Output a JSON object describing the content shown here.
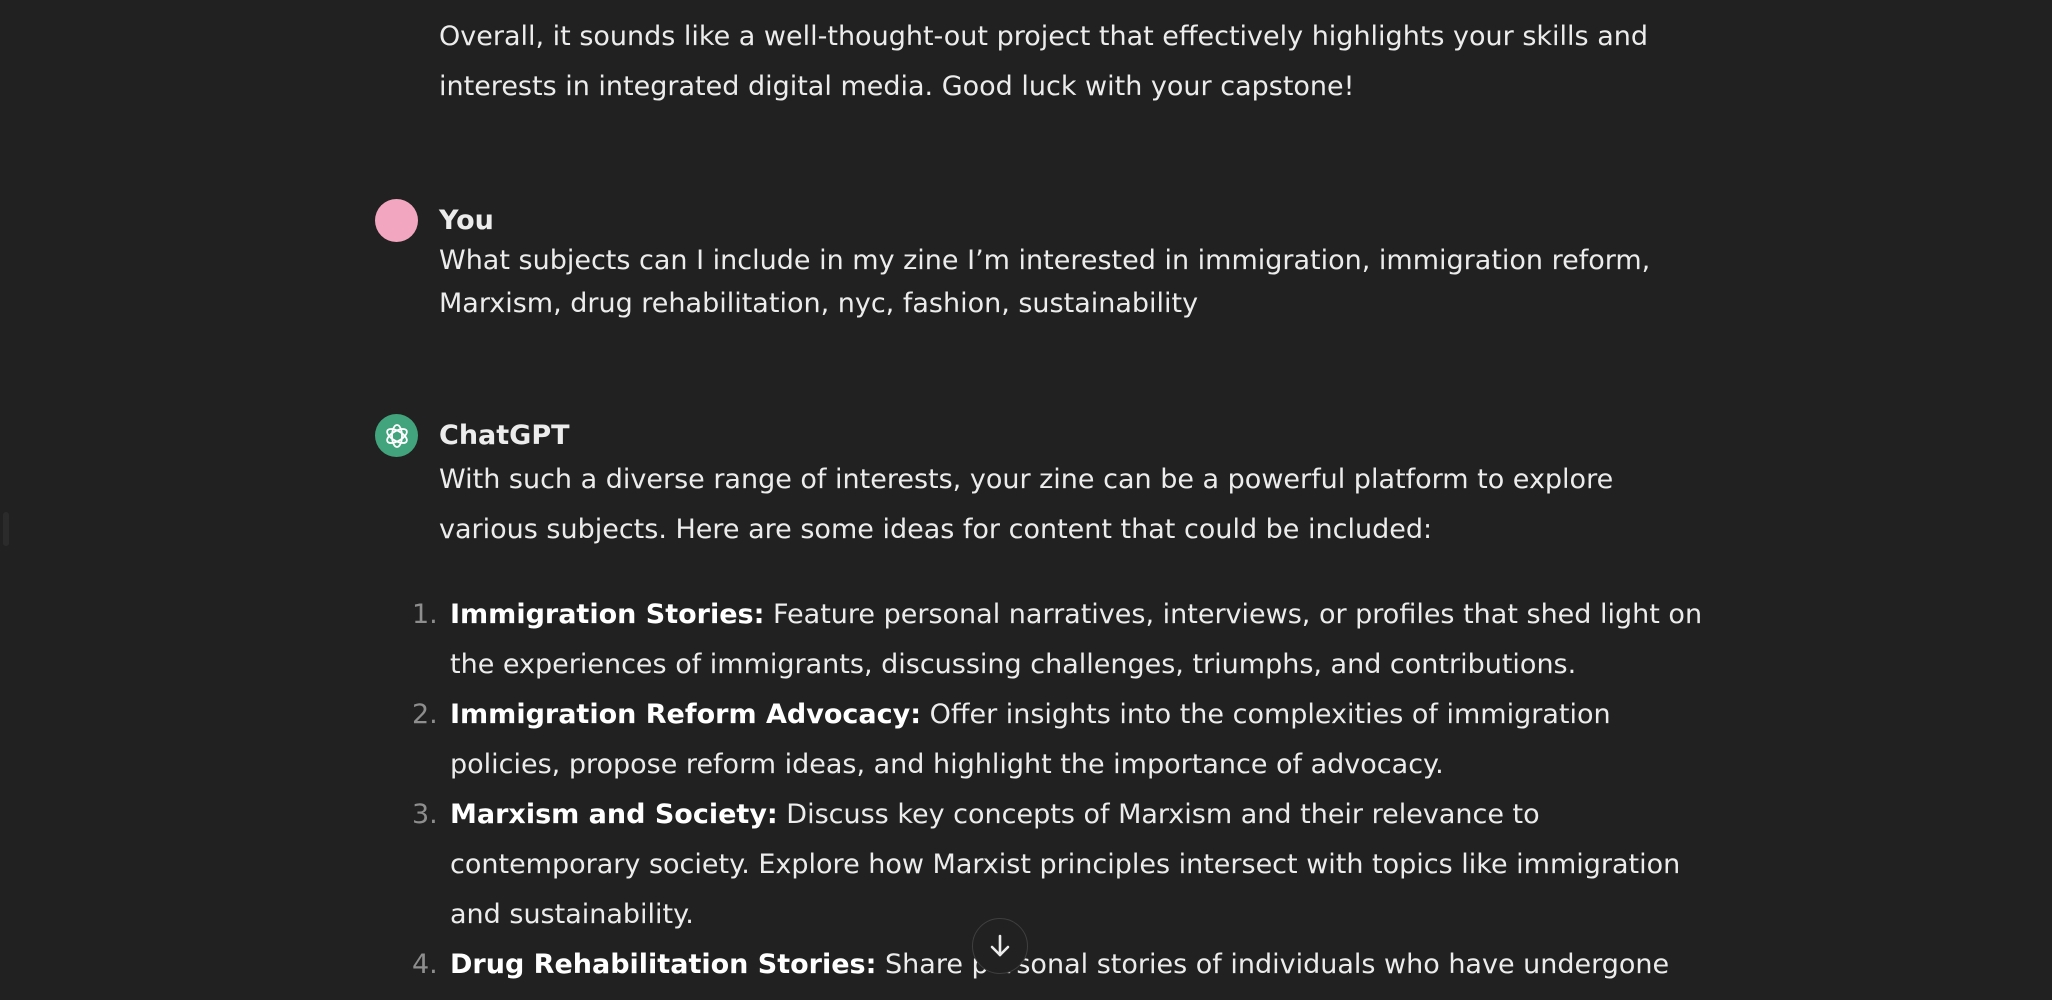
{
  "previous_message": {
    "text": "Overall, it sounds like a well-thought-out project that effectively highlights your skills and interests in integrated digital media. Good luck with your capstone!"
  },
  "user_turn": {
    "author": "You",
    "message": "What subjects can I include in my zine I’m interested in immigration, immigration reform, Marxism, drug rehabilitation, nyc, fashion, sustainability"
  },
  "assistant_turn": {
    "author": "ChatGPT",
    "intro": "With such a diverse range of interests, your zine can be a powerful platform to explore various subjects. Here are some ideas for content that could be included:",
    "items": [
      {
        "number": "1.",
        "title": "Immigration Stories:",
        "text": " Feature personal narratives, interviews, or profiles that shed light on the experiences of immigrants, discussing challenges, triumphs, and contributions."
      },
      {
        "number": "2.",
        "title": "Immigration Reform Advocacy:",
        "text": " Offer insights into the complexities of immigration policies, propose reform ideas, and highlight the importance of advocacy."
      },
      {
        "number": "3.",
        "title": "Marxism and Society:",
        "text": " Discuss key concepts of Marxism and their relevance to contemporary society. Explore how Marxist principles intersect with topics like immigration and sustainability."
      },
      {
        "number": "4.",
        "title": "Drug Rehabilitation Stories:",
        "text": " Share personal stories of individuals who have undergone successful drug rehabilitation, emphasizing the importance of support and understanding."
      }
    ]
  },
  "icons": {
    "assistant_avatar": "openai-logo-icon",
    "scroll_button": "arrow-down-icon"
  },
  "colors": {
    "background": "#212121",
    "user_avatar": "#f3a6bf",
    "assistant_avatar": "#41a47d",
    "text": "#ececec"
  }
}
